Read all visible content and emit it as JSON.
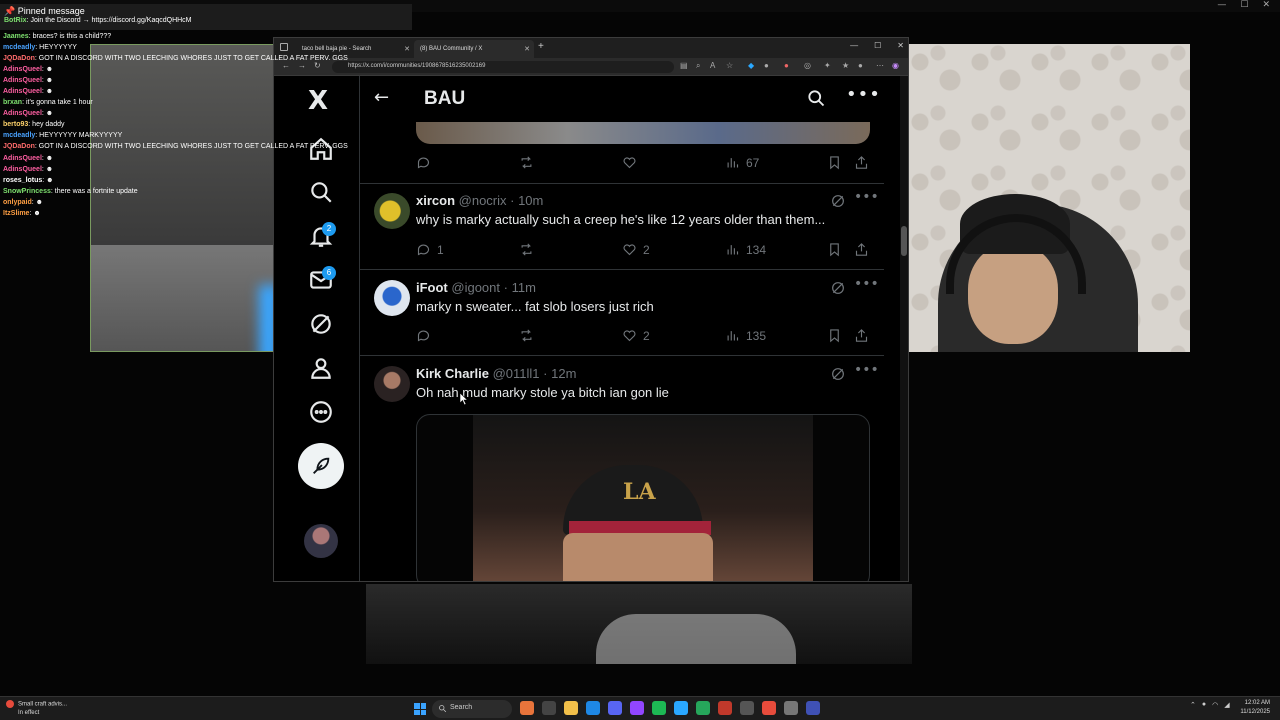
{
  "chat": {
    "pinned_header": "Pinned message",
    "pinned_user": "BotRix",
    "pinned_text": ": Join the Discord → https://discord.gg/KaqcdQHHcM",
    "lines": [
      {
        "user": "Jaames",
        "color": "#7ee06f",
        "text": ": braces? is this a child???"
      },
      {
        "user": "mcdeadly",
        "color": "#4aa3ff",
        "text": ": HEYYYYYY"
      },
      {
        "user": "JQDaDon",
        "color": "#ff6b6b",
        "text": ": GOT IN A DISCORD WITH TWO LEECHING WHORES JUST TO GET CALLED A FAT PERV. GGS"
      },
      {
        "user": "AdinsQueel",
        "color": "#ff5fa2",
        "text": ": ☻"
      },
      {
        "user": "AdinsQueel",
        "color": "#ff5fa2",
        "text": ": ☻"
      },
      {
        "user": "AdinsQueel",
        "color": "#ff5fa2",
        "text": ": ☻"
      },
      {
        "user": "brxan",
        "color": "#7ee06f",
        "text": ": it's gonna take 1 hour"
      },
      {
        "user": "AdinsQueel",
        "color": "#ff5fa2",
        "text": ": ☻"
      },
      {
        "user": "berto93",
        "color": "#ffd36b",
        "text": ": hey daddy"
      },
      {
        "user": "mcdeadly",
        "color": "#4aa3ff",
        "text": ": HEYYYYYY MARKYYYYY"
      },
      {
        "user": "JQDaDon",
        "color": "#ff6b6b",
        "text": ": GOT IN A DISCORD WITH TWO LEECHING WHORES JUST TO GET CALLED A FAT PERV. GGS"
      },
      {
        "user": "AdinsQueel",
        "color": "#ff5fa2",
        "text": ": ☻"
      },
      {
        "user": "AdinsQueel",
        "color": "#ff5fa2",
        "text": ": ☻"
      },
      {
        "user": "roses_lotus",
        "color": "#ffffff",
        "text": ": ☻"
      },
      {
        "user": "SnowPrincess",
        "color": "#7ee06f",
        "text": ": there was a fortnite update"
      },
      {
        "user": "onlypaid",
        "color": "#ff9f43",
        "text": ": ☻"
      },
      {
        "user": "ItzSlime",
        "color": "#ff9f43",
        "text": ": ☻"
      }
    ]
  },
  "browser": {
    "tab1_title": "taco bell baja pie - Search",
    "tab2_title": "(8) BAU Community / X",
    "url": "https://x.com/i/communities/1908678516235002169"
  },
  "x": {
    "logo": "X",
    "header_title": "BAU",
    "notif_badge": "2",
    "msg_badge": "6",
    "top_stats": {
      "views": "67"
    },
    "tweets": [
      {
        "name": "xircon",
        "handle": "@nocrix",
        "time": "· 10m",
        "text": "why is marky actually such a creep he's like 12 years older than them...",
        "replies": "1",
        "likes": "2",
        "views": "134"
      },
      {
        "name": "iFoot",
        "handle": "@igoont",
        "time": "· 11m",
        "text": "marky n sweater... fat slob losers just rich",
        "replies": "",
        "likes": "2",
        "views": "135"
      },
      {
        "name": "Kirk Charlie",
        "handle": "@011ll1",
        "time": "· 12m",
        "text": "Oh nah mud marky stole ya bitch ian gon lie"
      }
    ],
    "media_logo": "LA"
  },
  "taskbar": {
    "weather_title": "Small craft advis...",
    "weather_sub": "In effect",
    "search": "Search",
    "time": "12:02 AM",
    "date": "11/12/2025"
  },
  "colors": {
    "accent": "#1d9bf0",
    "bg": "#000000",
    "muted": "#71767b"
  }
}
